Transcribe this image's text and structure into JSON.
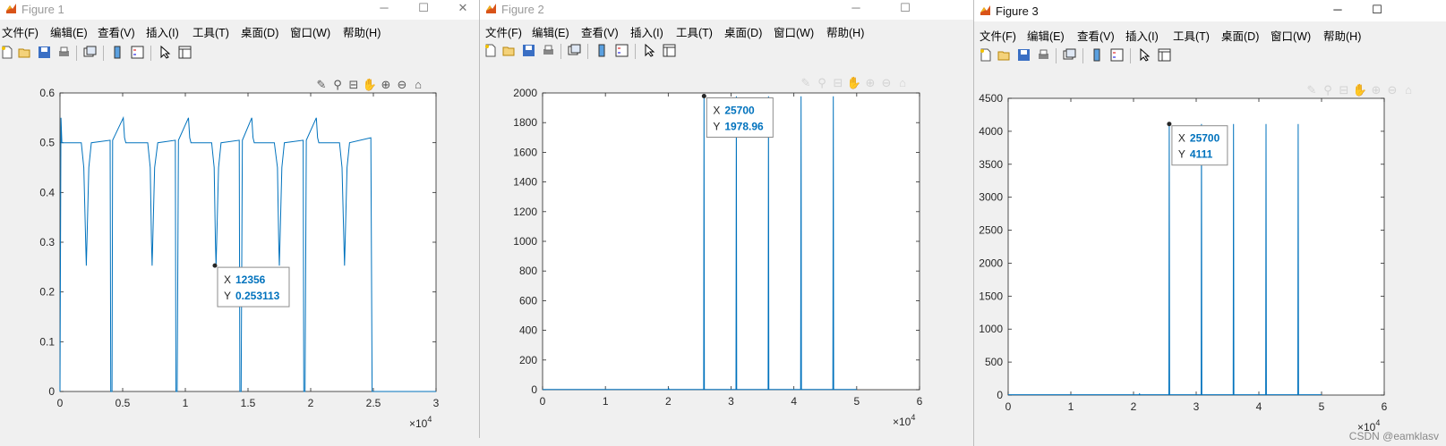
{
  "menu": [
    "文件(F)",
    "编辑(E)",
    "查看(V)",
    "插入(I)",
    "工具(T)",
    "桌面(D)",
    "窗口(W)",
    "帮助(H)"
  ],
  "watermark": "CSDN @eamklasv",
  "figures": [
    {
      "title": "Figure 1",
      "controls": {
        "minimize": "─",
        "maximize": "☐",
        "close": "✕"
      },
      "chart_data": {
        "type": "line",
        "xlim": [
          0,
          30000
        ],
        "ylim": [
          0,
          0.6
        ],
        "xticks": [
          0,
          5000,
          10000,
          15000,
          20000,
          25000,
          30000
        ],
        "xtick_labels": [
          "0",
          "0.5",
          "1",
          "1.5",
          "2",
          "2.5",
          "3"
        ],
        "yticks": [
          0,
          0.1,
          0.2,
          0.3,
          0.4,
          0.5,
          0.6
        ],
        "ytick_labels": [
          "0",
          "0.1",
          "0.2",
          "0.3",
          "0.4",
          "0.5",
          "0.6"
        ],
        "x_exponent": "10",
        "x_exponent_power": "4",
        "grid": false,
        "series": [
          {
            "color": "#0072bd",
            "x": [
              0,
              80,
              150,
              200,
              1700,
              1900,
              2050,
              2100,
              2150,
              2300,
              2500,
              4000,
              4050,
              4150,
              4200,
              5050,
              5150,
              5250,
              5400,
              7000,
              7200,
              7300,
              7350,
              7400,
              7550,
              7800,
              9200,
              9250,
              9350,
              9450,
              10250,
              10350,
              10450,
              10600,
              12100,
              12300,
              12400,
              12450,
              12500,
              12650,
              12850,
              14300,
              14350,
              14450,
              14550,
              15300,
              15400,
              15500,
              15650,
              17100,
              17350,
              17450,
              17500,
              17550,
              17700,
              17900,
              19400,
              19450,
              19550,
              19650,
              20450,
              20550,
              20650,
              20800,
              22300,
              22500,
              22650,
              22700,
              22750,
              22900,
              23100,
              24800,
              24900,
              25100,
              30000
            ],
            "y": [
              0,
              0.55,
              0.5,
              0.5,
              0.5,
              0.45,
              0.3,
              0.253,
              0.3,
              0.45,
              0.5,
              0.505,
              0,
              0,
              0.505,
              0.55,
              0.51,
              0.5,
              0.5,
              0.5,
              0.45,
              0.3,
              0.253,
              0.3,
              0.45,
              0.5,
              0.505,
              0,
              0,
              0.505,
              0.55,
              0.51,
              0.5,
              0.5,
              0.5,
              0.45,
              0.3,
              0.253,
              0.3,
              0.45,
              0.5,
              0.505,
              0,
              0,
              0.505,
              0.55,
              0.51,
              0.5,
              0.5,
              0.5,
              0.45,
              0.3,
              0.253,
              0.3,
              0.45,
              0.5,
              0.505,
              0,
              0,
              0.505,
              0.55,
              0.51,
              0.5,
              0.5,
              0.5,
              0.45,
              0.3,
              0.253,
              0.3,
              0.45,
              0.5,
              0.51,
              0,
              0,
              0
            ]
          }
        ],
        "datatip": {
          "x_label": "X",
          "x_value": "12356",
          "y_label": "Y",
          "y_value": "0.253113",
          "at": [
            12356,
            0.253113
          ]
        }
      }
    },
    {
      "title": "Figure 2",
      "controls": {
        "minimize": "─",
        "maximize": "☐",
        "close": "✕"
      },
      "chart_data": {
        "type": "line",
        "xlim": [
          0,
          60000
        ],
        "ylim": [
          0,
          2000
        ],
        "xticks": [
          0,
          10000,
          20000,
          30000,
          40000,
          50000,
          60000
        ],
        "xtick_labels": [
          "0",
          "1",
          "2",
          "3",
          "4",
          "5",
          "6"
        ],
        "yticks": [
          0,
          200,
          400,
          600,
          800,
          1000,
          1200,
          1400,
          1600,
          1800,
          2000
        ],
        "ytick_labels": [
          "0",
          "200",
          "400",
          "600",
          "800",
          "1000",
          "1200",
          "1400",
          "1600",
          "1800",
          "2000"
        ],
        "x_exponent": "10",
        "x_exponent_power": "4",
        "grid": false,
        "series": [
          {
            "color": "#0072bd",
            "x": [
              0,
              20000,
              20050,
              20100,
              25640,
              25700,
              25760,
              30780,
              30840,
              30900,
              35900,
              35960,
              36020,
              41080,
              41140,
              41200,
              46210,
              46270,
              46330,
              50000
            ],
            "y": [
              2,
              2,
              12,
              2,
              2,
              1978.96,
              2,
              2,
              1978,
              2,
              2,
              1978,
              2,
              2,
              1978,
              2,
              2,
              1978,
              2,
              2
            ]
          }
        ],
        "datatip": {
          "x_label": "X",
          "x_value": "25700",
          "y_label": "Y",
          "y_value": "1978.96",
          "at": [
            25700,
            1978.96
          ]
        }
      }
    },
    {
      "title": "Figure 3",
      "controls": {
        "minimize": "─",
        "maximize": "☐"
      },
      "chart_data": {
        "type": "line",
        "xlim": [
          0,
          60000
        ],
        "ylim": [
          0,
          4500
        ],
        "xticks": [
          0,
          10000,
          20000,
          30000,
          40000,
          50000,
          60000
        ],
        "xtick_labels": [
          "0",
          "1",
          "2",
          "3",
          "4",
          "5",
          "6"
        ],
        "yticks": [
          0,
          500,
          1000,
          1500,
          2000,
          2500,
          3000,
          3500,
          4000,
          4500
        ],
        "ytick_labels": [
          "0",
          "500",
          "1000",
          "1500",
          "2000",
          "2500",
          "3000",
          "3500",
          "4000",
          "4500"
        ],
        "x_exponent": "10",
        "x_exponent_power": "4",
        "grid": false,
        "series": [
          {
            "color": "#0072bd",
            "x": [
              0,
              20900,
              20950,
              21000,
              25640,
              25700,
              25760,
              30780,
              30840,
              30900,
              35900,
              35960,
              36020,
              41080,
              41140,
              41200,
              46210,
              46270,
              46330,
              50000
            ],
            "y": [
              5,
              5,
              25,
              5,
              5,
              4111,
              5,
              5,
              4111,
              5,
              5,
              4111,
              5,
              5,
              4111,
              5,
              5,
              4111,
              5,
              5
            ]
          }
        ],
        "datatip": {
          "x_label": "X",
          "x_value": "25700",
          "y_label": "Y",
          "y_value": "4111",
          "at": [
            25700,
            4111
          ]
        }
      }
    }
  ]
}
